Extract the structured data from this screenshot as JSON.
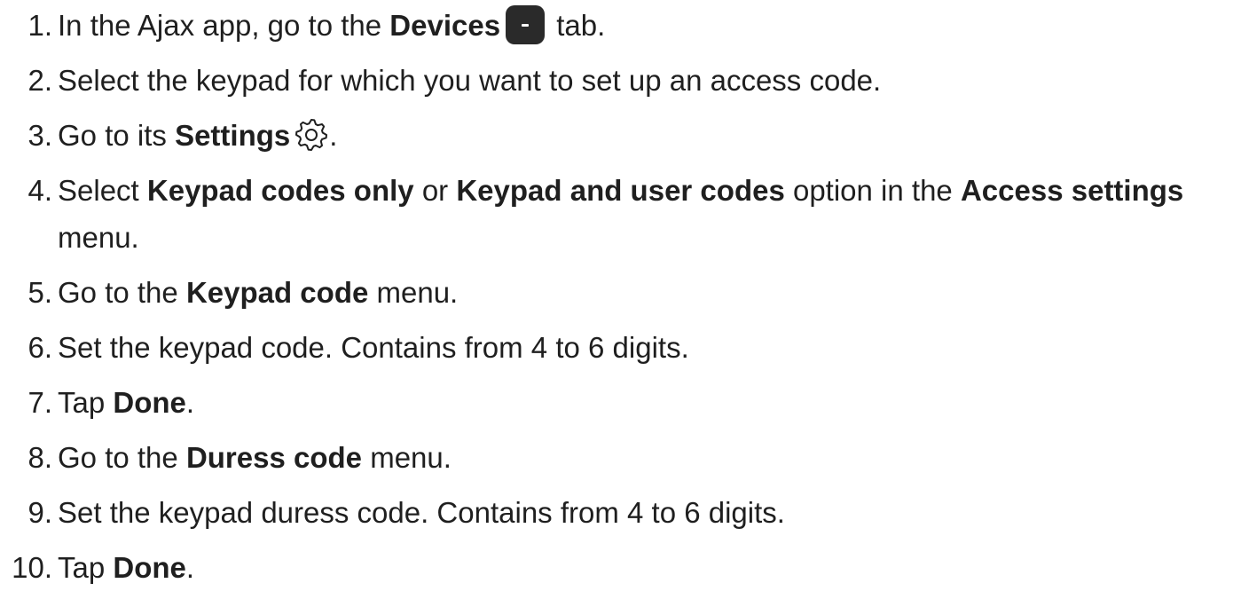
{
  "steps": [
    {
      "n": "1.",
      "parts": [
        {
          "t": "In the Ajax app, go to the "
        },
        {
          "t": "Devices",
          "b": true
        },
        {
          "icon": "devices-tab-icon"
        },
        {
          "t": " tab."
        }
      ]
    },
    {
      "n": "2.",
      "parts": [
        {
          "t": "Select the keypad for which you want to set up an access code."
        }
      ]
    },
    {
      "n": "3.",
      "parts": [
        {
          "t": "Go to its "
        },
        {
          "t": "Settings",
          "b": true
        },
        {
          "icon": "gear-icon"
        },
        {
          "t": "."
        }
      ]
    },
    {
      "n": "4.",
      "parts": [
        {
          "t": "Select "
        },
        {
          "t": "Keypad codes only",
          "b": true
        },
        {
          "t": " or "
        },
        {
          "t": "Keypad and user codes",
          "b": true
        },
        {
          "t": " option in the "
        },
        {
          "t": "Access settings",
          "b": true
        },
        {
          "t": " menu."
        }
      ]
    },
    {
      "n": "5.",
      "parts": [
        {
          "t": "Go to the "
        },
        {
          "t": "Keypad code",
          "b": true
        },
        {
          "t": " menu."
        }
      ]
    },
    {
      "n": "6.",
      "parts": [
        {
          "t": "Set the keypad code. Contains from 4 to 6 digits."
        }
      ]
    },
    {
      "n": "7.",
      "parts": [
        {
          "t": "Tap "
        },
        {
          "t": "Done",
          "b": true
        },
        {
          "t": "."
        }
      ]
    },
    {
      "n": "8.",
      "parts": [
        {
          "t": "Go to the "
        },
        {
          "t": "Duress code",
          "b": true
        },
        {
          "t": " menu."
        }
      ]
    },
    {
      "n": "9.",
      "parts": [
        {
          "t": "Set the keypad duress code. Contains from 4 to 6 digits."
        }
      ]
    },
    {
      "n": "10.",
      "parts": [
        {
          "t": "Tap "
        },
        {
          "t": "Done",
          "b": true
        },
        {
          "t": "."
        }
      ]
    }
  ]
}
